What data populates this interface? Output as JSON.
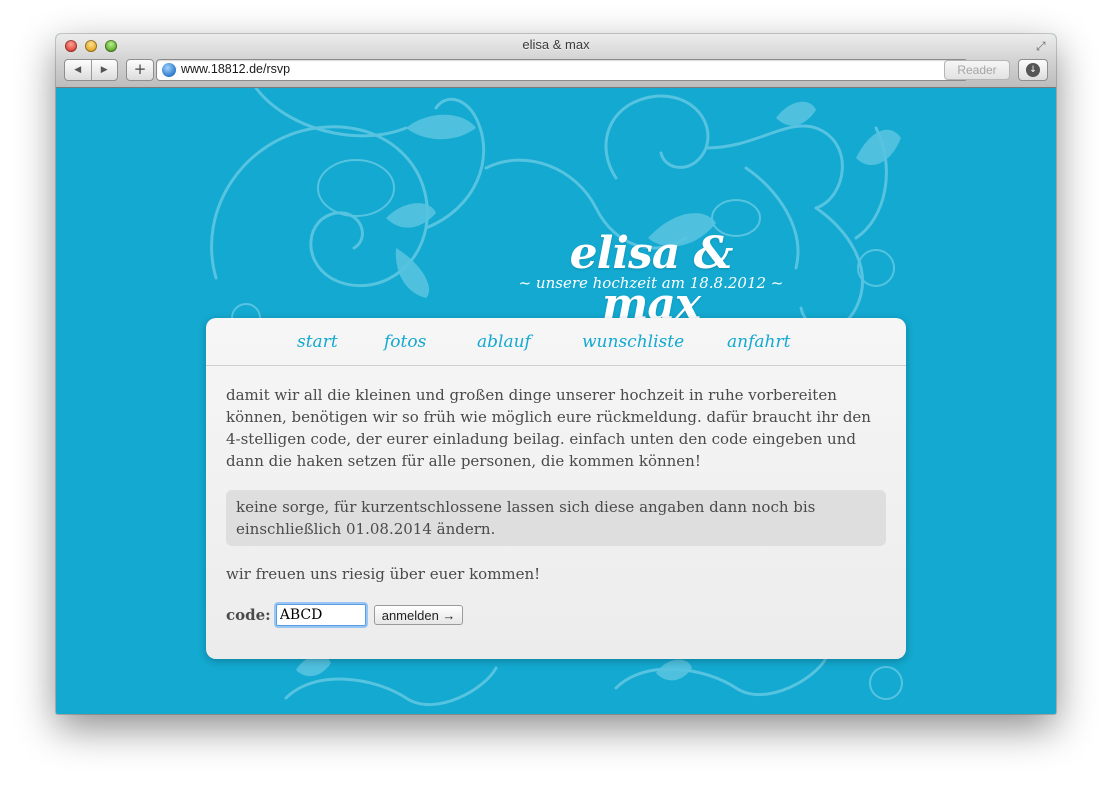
{
  "browser": {
    "window_title": "elisa & max",
    "url": "www.18812.de/rsvp",
    "back_glyph": "◀",
    "forward_glyph": "▶",
    "add_glyph": "+",
    "reload_glyph": "↻",
    "reader_label": "Reader",
    "download_glyph": "↓",
    "fullscreen_glyph": "⤢"
  },
  "site": {
    "title": "elisa & max",
    "subtitle": "~ unsere hochzeit am 18.8.2012 ~"
  },
  "nav": {
    "items": [
      {
        "label": "start"
      },
      {
        "label": "fotos"
      },
      {
        "label": "ablauf"
      },
      {
        "label": "wunschliste"
      },
      {
        "label": "anfahrt"
      }
    ]
  },
  "content": {
    "intro": "damit wir all die kleinen und großen dinge unserer hochzeit in ruhe vorbereiten können, benötigen wir so früh wie möglich eure rückmeldung. dafür braucht ihr den 4-stelligen code, der eurer einladung beilag. einfach unten den code eingeben und dann die haken setzen für alle personen, die kommen können!",
    "note": "keine sorge, für kurzentschlossene lassen sich diese angaben dann noch bis einschließlich 01.08.2014 ändern.",
    "thanks": "wir freuen uns riesig über euer kommen!"
  },
  "form": {
    "code_label": "code:",
    "code_value": "ABCD",
    "submit_label": "anmelden →"
  },
  "colors": {
    "page_background": "#13a9d0",
    "link": "#13a9d0",
    "ornament": "#56c3e0"
  }
}
